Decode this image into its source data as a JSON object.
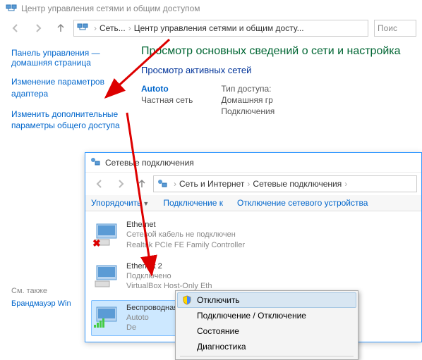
{
  "main": {
    "title": "Центр управления сетями и общим доступом",
    "breadcrumb": {
      "b1": "Сеть...",
      "b2": "Центр управления сетями и общим досту..."
    },
    "search_placeholder": "Поис",
    "sidebar": {
      "heading": "Панель управления — домашняя страница",
      "link1": "Изменение параметров адаптера",
      "link2": "Изменить дополнительные параметры общего доступа",
      "see_also": "См. также",
      "firewall": "Брандмауэр Win"
    },
    "pane": {
      "title": "Просмотр основных сведений о сети и настройка",
      "section": "Просмотр активных сетей",
      "net_name": "Autoto",
      "net_type": "Частная сеть",
      "access_type_label": "Тип доступа:",
      "homegroup_label": "Домашняя гр",
      "connections_label": "Подключения"
    }
  },
  "win2": {
    "title": "Сетевые подключения",
    "breadcrumb": {
      "b1": "Сеть и Интернет",
      "b2": "Сетевые подключения"
    },
    "toolbar": {
      "organize": "Упорядочить",
      "connect": "Подключение к",
      "disable": "Отключение сетевого устройства"
    },
    "adapters": {
      "a1": {
        "name": "Ethernet",
        "status": "Сетевой кабель не подключен",
        "dev": "Realtek PCIe FE Family Controller"
      },
      "a2": {
        "name": "Ethernet 2",
        "status": "Подключено",
        "dev": "VirtualBox Host-Only Eth"
      },
      "a3": {
        "name": "Беспроводная сеть",
        "status": "Autoto",
        "dev": "De"
      }
    }
  },
  "menu": {
    "disable": "Отключить",
    "conn": "Подключение / Отключение",
    "status": "Состояние",
    "diag": "Диагностика"
  }
}
